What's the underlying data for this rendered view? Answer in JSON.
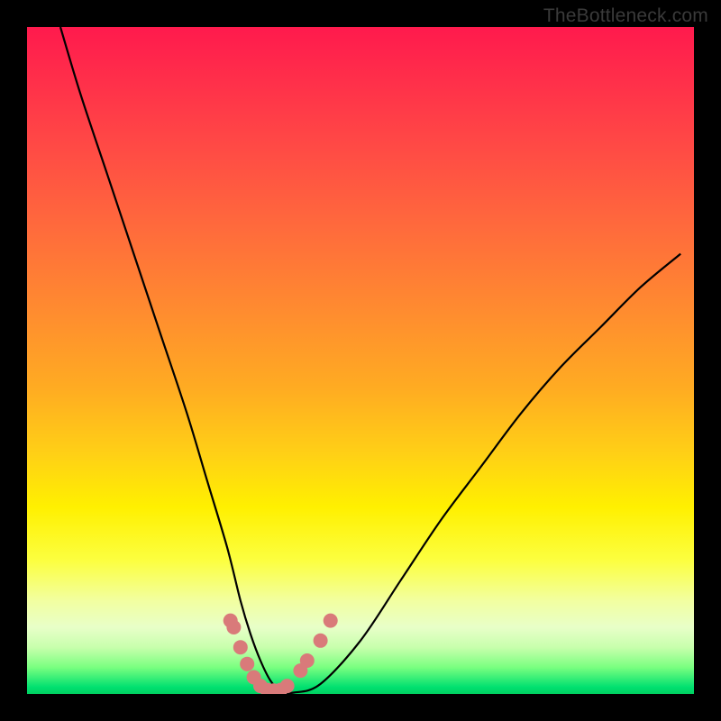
{
  "watermark": "TheBottleneck.com",
  "chart_data": {
    "type": "line",
    "title": "",
    "xlabel": "",
    "ylabel": "",
    "xlim": [
      0,
      100
    ],
    "ylim": [
      0,
      100
    ],
    "grid": false,
    "legend": false,
    "series": [
      {
        "name": "curve",
        "color": "#000000",
        "x": [
          5,
          8,
          12,
          16,
          20,
          24,
          27,
          30,
          32,
          33.5,
          35,
          36.5,
          38,
          40,
          44,
          50,
          56,
          62,
          68,
          74,
          80,
          86,
          92,
          98
        ],
        "y": [
          100,
          90,
          78,
          66,
          54,
          42,
          32,
          22,
          14,
          9,
          5,
          2,
          0.5,
          0.2,
          1.5,
          8,
          17,
          26,
          34,
          42,
          49,
          55,
          61,
          66
        ]
      },
      {
        "name": "valley-dots",
        "color": "#d97a7a",
        "type": "scatter",
        "x": [
          30.5,
          31,
          32,
          33,
          34,
          35,
          36,
          37,
          38,
          39,
          41,
          42,
          44,
          45.5
        ],
        "y": [
          11,
          10,
          7,
          4.5,
          2.5,
          1.2,
          0.6,
          0.5,
          0.6,
          1.2,
          3.5,
          5,
          8,
          11
        ]
      }
    ]
  }
}
